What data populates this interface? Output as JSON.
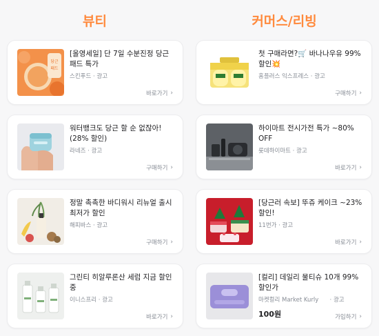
{
  "sections": {
    "beauty_title": "뷰티",
    "commerce_title": "커머스/리빙"
  },
  "beauty_ads": [
    {
      "title": "[올영세일] 단 7일 수분진정 당근패드 특가",
      "advertiser": "스킨푸드 · 광고",
      "cta": "바로가기"
    },
    {
      "title": "워터뱅크도 당근 할 순 없잖아!(28% 할인)",
      "advertiser": "라네즈 · 광고",
      "cta": "구매하기"
    },
    {
      "title": "정말 촉촉한 바디워시 리뉴얼 출시 최저가 할인",
      "advertiser": "해피바스 · 광고",
      "cta": "구매하기"
    },
    {
      "title": "그린티 히알루론산 세럼 지금 할인 중",
      "advertiser": "이니스프리 · 광고",
      "cta": "바로가기"
    }
  ],
  "commerce_ads": [
    {
      "title": "첫 구매라면?🛒 바나나우유 99% 할인💥",
      "advertiser": "홈플러스 익스프레스 · 광고",
      "cta": "구매하기"
    },
    {
      "title": "하이마트 전시가전 특가 ~80% OFF",
      "advertiser": "롯데하이마트 · 광고",
      "cta": "바로가기"
    },
    {
      "title": "[당근러 속보] 뚜쥬 케이크 ~23% 할인!",
      "advertiser": "11번가 · 광고",
      "cta": "바로가기"
    },
    {
      "title": "[컬리] 데일리 물티슈 10개 99% 할인가",
      "advertiser": "마켓컬리 Market Kurly      · 광고",
      "price": "100원",
      "cta": "가입하기"
    }
  ],
  "icons": {
    "cta_arrow": "chevron-right-icon"
  },
  "colors": {
    "accent": "#ff8a3d",
    "muted_text": "#868b94",
    "card_bg": "#ffffff",
    "page_bg": "#f7f7f8"
  }
}
